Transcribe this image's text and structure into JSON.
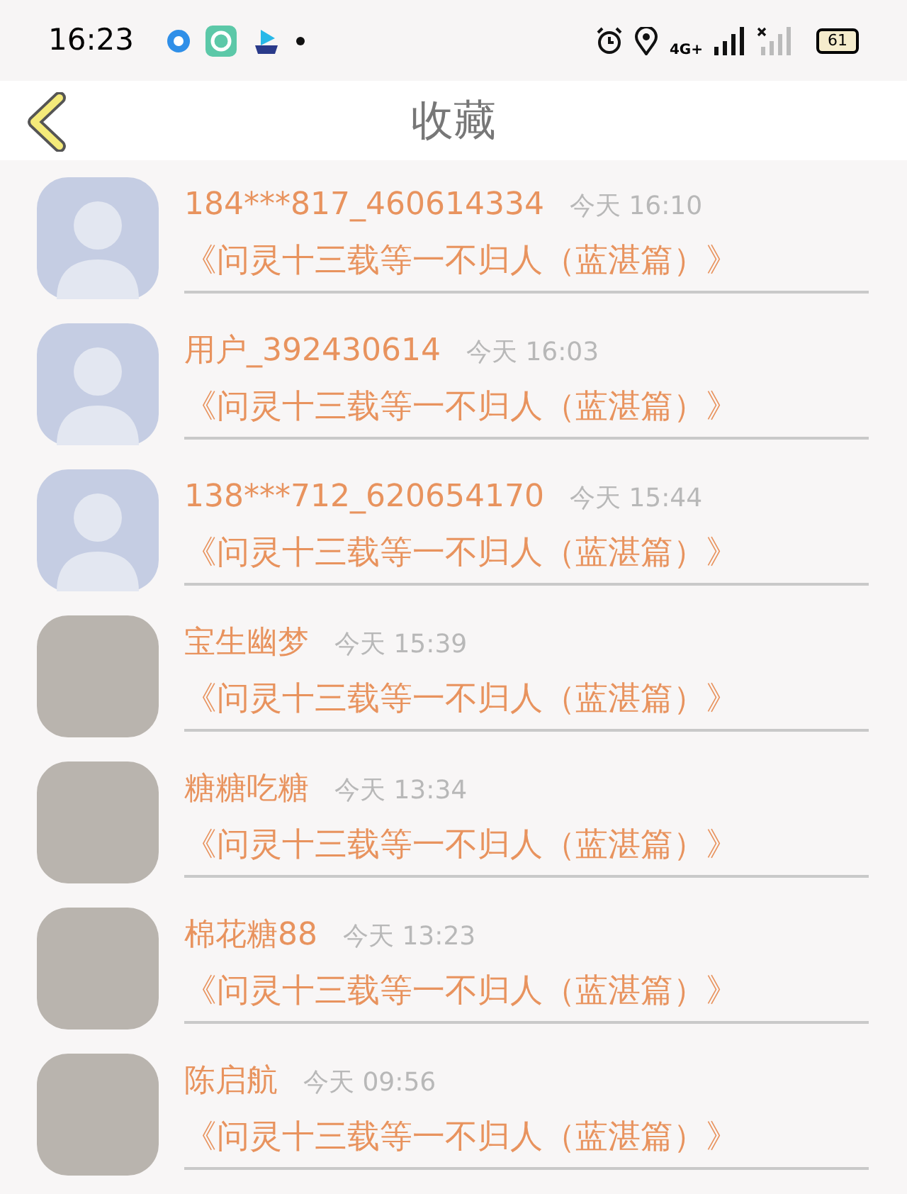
{
  "status_bar": {
    "time": "16:23",
    "network": "4G+",
    "battery": "61"
  },
  "header": {
    "title": "收藏"
  },
  "items": [
    {
      "user": "184***817_460614334",
      "time": "今天 16:10",
      "book": "《问灵十三载等一不归人（蓝湛篇）》",
      "kind": "default"
    },
    {
      "user": "用户_392430614",
      "time": "今天 16:03",
      "book": "《问灵十三载等一不归人（蓝湛篇）》",
      "kind": "default"
    },
    {
      "user": "138***712_620654170",
      "time": "今天 15:44",
      "book": "《问灵十三载等一不归人（蓝湛篇）》",
      "kind": "default"
    },
    {
      "user": "宝生幽梦",
      "time": "今天 15:39",
      "book": "《问灵十三载等一不归人（蓝湛篇）》",
      "kind": "picture"
    },
    {
      "user": "糖糖吃糖",
      "time": "今天 13:34",
      "book": "《问灵十三载等一不归人（蓝湛篇）》",
      "kind": "picture"
    },
    {
      "user": "棉花糖88",
      "time": "今天 13:23",
      "book": "《问灵十三载等一不归人（蓝湛篇）》",
      "kind": "picture"
    },
    {
      "user": "陈启航",
      "time": "今天 09:56",
      "book": "《问灵十三载等一不归人（蓝湛篇）》",
      "kind": "picture"
    }
  ]
}
